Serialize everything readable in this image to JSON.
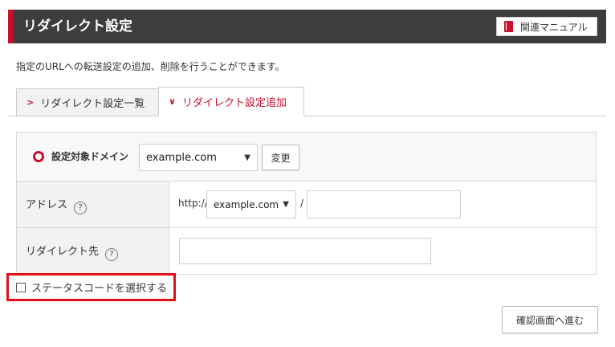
{
  "header": {
    "title": "リダイレクト設定",
    "manual_label": "関連マニュアル"
  },
  "description": "指定のURLへの転送設定の追加、削除を行うことができます。",
  "tabs": [
    {
      "label": "リダイレクト設定一覧",
      "active": false
    },
    {
      "label": "リダイレクト設定追加",
      "active": true
    }
  ],
  "form": {
    "domain_label": "設定対象ドメイン",
    "domain_value": "example.com",
    "change_label": "変更",
    "address_label": "アドレス",
    "help_glyph": "?",
    "prefix": "http://",
    "address_domain": "example.com",
    "slash": "/",
    "redirect_label": "リダイレクト先"
  },
  "status_code_label": "ステータスコードを選択する",
  "confirm_label": "確認画面へ進む",
  "colors": {
    "accent": "#c8102e",
    "header_bg": "#3d3d3d",
    "highlight_border": "#e0101a"
  }
}
